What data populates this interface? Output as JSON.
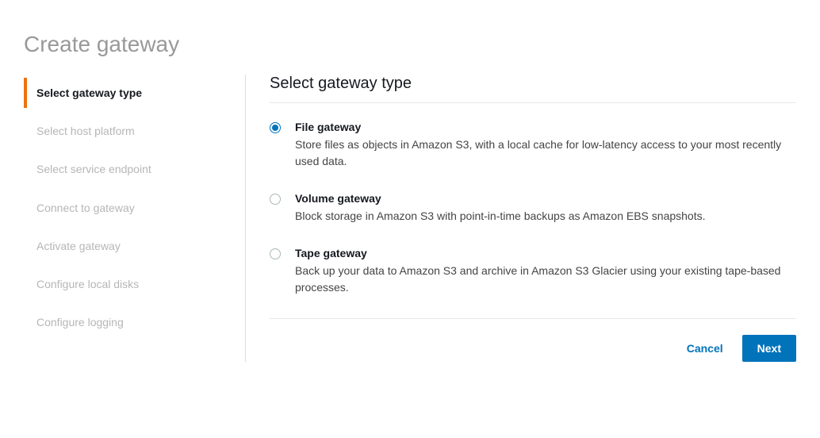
{
  "page": {
    "title": "Create gateway"
  },
  "sidebar": {
    "items": [
      {
        "label": "Select gateway type",
        "active": true
      },
      {
        "label": "Select host platform",
        "active": false
      },
      {
        "label": "Select service endpoint",
        "active": false
      },
      {
        "label": "Connect to gateway",
        "active": false
      },
      {
        "label": "Activate gateway",
        "active": false
      },
      {
        "label": "Configure local disks",
        "active": false
      },
      {
        "label": "Configure logging",
        "active": false
      }
    ]
  },
  "main": {
    "heading": "Select gateway type",
    "options": [
      {
        "title": "File gateway",
        "description": "Store files as objects in Amazon S3, with a local cache for low-latency access to your most recently used data.",
        "selected": true
      },
      {
        "title": "Volume gateway",
        "description": "Block storage in Amazon S3 with point-in-time backups as Amazon EBS snapshots.",
        "selected": false
      },
      {
        "title": "Tape gateway",
        "description": "Back up your data to Amazon S3 and archive in Amazon S3 Glacier using your existing tape-based processes.",
        "selected": false
      }
    ],
    "actions": {
      "cancel": "Cancel",
      "next": "Next"
    }
  }
}
